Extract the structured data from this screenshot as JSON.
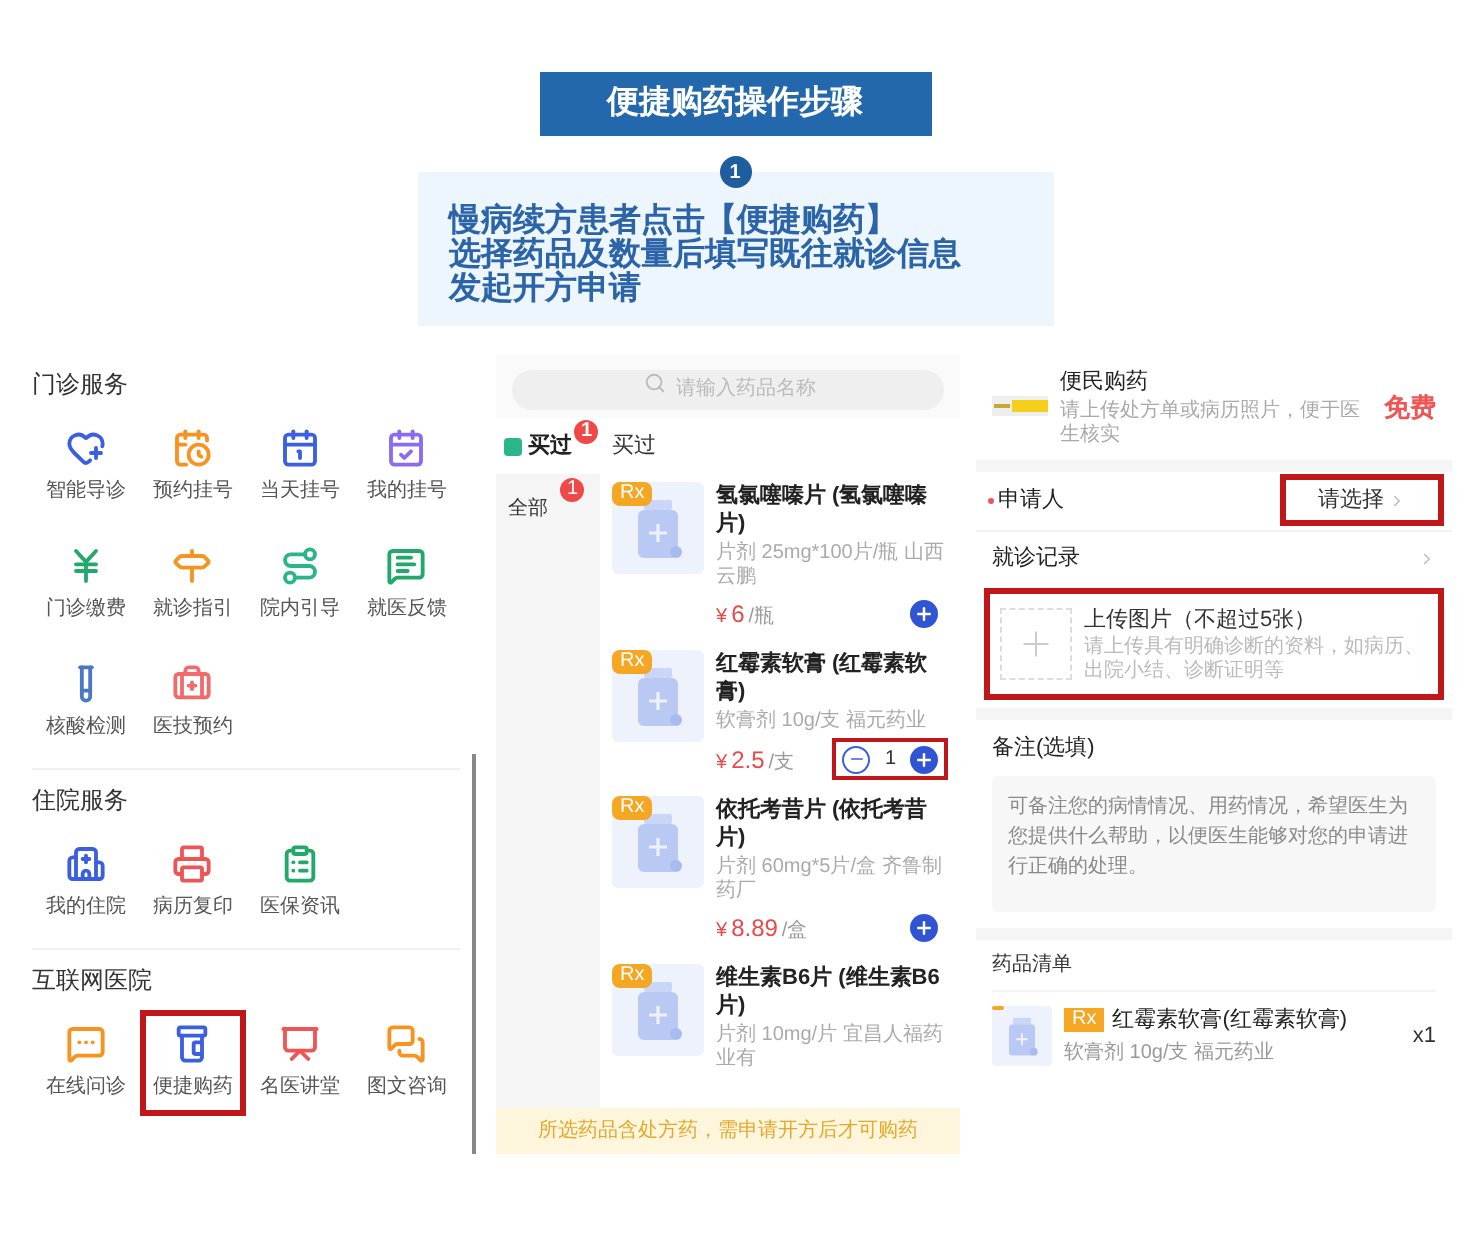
{
  "header": {
    "title": "便捷购药操作步骤",
    "step": "1",
    "lines": [
      "慢病续方患者点击【便捷购药】",
      "选择药品及数量后填写既往就诊信息",
      "发起开方申请"
    ]
  },
  "services": {
    "sections": [
      {
        "title": "门诊服务",
        "items": [
          {
            "label": "智能导诊",
            "highlighted": false
          },
          {
            "label": "预约挂号",
            "highlighted": false
          },
          {
            "label": "当天挂号",
            "highlighted": false
          },
          {
            "label": "我的挂号",
            "highlighted": false
          },
          {
            "label": "门诊缴费",
            "highlighted": false
          },
          {
            "label": "就诊指引",
            "highlighted": false
          },
          {
            "label": "院内引导",
            "highlighted": false
          },
          {
            "label": "就医反馈",
            "highlighted": false
          },
          {
            "label": "核酸检测",
            "highlighted": false
          },
          {
            "label": "医技预约",
            "highlighted": false
          }
        ]
      },
      {
        "title": "住院服务",
        "items": [
          {
            "label": "我的住院",
            "highlighted": false
          },
          {
            "label": "病历复印",
            "highlighted": false
          },
          {
            "label": "医保资讯",
            "highlighted": false
          }
        ]
      },
      {
        "title": "互联网医院",
        "items": [
          {
            "label": "在线问诊",
            "highlighted": false
          },
          {
            "label": "便捷购药",
            "highlighted": true
          },
          {
            "label": "名医讲堂",
            "highlighted": false
          },
          {
            "label": "图文咨询",
            "highlighted": false
          }
        ]
      }
    ]
  },
  "pharmacy": {
    "search": {
      "placeholder": "请输入药品名称"
    },
    "tab": {
      "label": "买过",
      "badge": "1"
    },
    "category": {
      "label": "全部",
      "badge": "1"
    },
    "list_title": "买过",
    "drugs": [
      {
        "badge": "Rx",
        "name": "氢氯噻嗪片 (氢氯噻嗪片)",
        "spec": "片剂 25mg*100片/瓶 山西云鹏",
        "currency": "¥",
        "price": "6",
        "unit": "/瓶",
        "highlighted": false
      },
      {
        "badge": "Rx",
        "name": "红霉素软膏 (红霉素软膏)",
        "spec": "软膏剂 10g/支 福元药业",
        "currency": "¥",
        "price": "2.5",
        "unit": "/支",
        "quantity": "1",
        "highlighted": true
      },
      {
        "badge": "Rx",
        "name": "依托考昔片 (依托考昔片)",
        "spec": "片剂 60mg*5片/盒 齐鲁制药厂",
        "currency": "¥",
        "price": "8.89",
        "unit": "/盒",
        "highlighted": false
      },
      {
        "badge": "Rx",
        "name": "维生素B6片 (维生素B6片)",
        "spec": "片剂 10mg/片 宜昌人福药业有"
      }
    ],
    "notice": "所选药品含处方药，需申请开方后才可购药"
  },
  "application": {
    "header": {
      "title": "便民购药",
      "subtitle": "请上传处方单或病历照片，便于医生核实",
      "price": "免费"
    },
    "applicant": {
      "label": "申请人",
      "required": true,
      "value": "请选择",
      "highlighted": true
    },
    "record": {
      "label": "就诊记录"
    },
    "upload": {
      "title": "上传图片（不超过5张）",
      "hint": "请上传具有明确诊断的资料，如病历、出院小结、诊断证明等",
      "highlighted": true
    },
    "note": {
      "label": "备注(选填)",
      "placeholder": "可备注您的病情情况、用药情况，希望医生为您提供什么帮助，以便医生能够对您的申请进行正确的处理。"
    },
    "list": {
      "title": "药品清单",
      "items": [
        {
          "badge": "Rx",
          "name": "红霉素软膏(红霉素软膏)",
          "spec": "软膏剂 10g/支 福元药业",
          "quantity": "x1"
        }
      ]
    }
  }
}
